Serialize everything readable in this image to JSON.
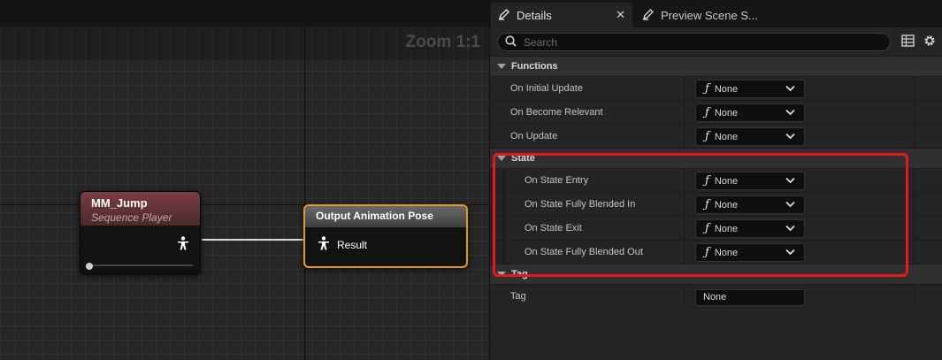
{
  "graph": {
    "zoom_label": "Zoom 1:1",
    "node_jump": {
      "title": "MM_Jump",
      "subtitle": "Sequence Player"
    },
    "node_output": {
      "title": "Output Animation Pose",
      "pin_label": "Result"
    }
  },
  "tabs": [
    {
      "label": "Details",
      "icon": "pencil-icon",
      "active": true
    },
    {
      "label": "Preview Scene S...",
      "icon": "pencil-icon",
      "active": false
    }
  ],
  "search": {
    "placeholder": "Search"
  },
  "sections": {
    "functions": {
      "title": "Functions",
      "props": [
        {
          "label": "On Initial Update",
          "value": "None"
        },
        {
          "label": "On Become Relevant",
          "value": "None"
        },
        {
          "label": "On Update",
          "value": "None"
        }
      ]
    },
    "state": {
      "title": "State",
      "props": [
        {
          "label": "On State Entry",
          "value": "None"
        },
        {
          "label": "On State Fully Blended In",
          "value": "None"
        },
        {
          "label": "On State Exit",
          "value": "None"
        },
        {
          "label": "On State Fully Blended Out",
          "value": "None"
        }
      ]
    },
    "tag": {
      "title": "Tag",
      "props": [
        {
          "label": "Tag",
          "value": "None"
        }
      ]
    }
  },
  "colors": {
    "highlight": "#e31b1b",
    "output_node_border": "#e59a1f",
    "jump_header": "#7a3c42"
  }
}
